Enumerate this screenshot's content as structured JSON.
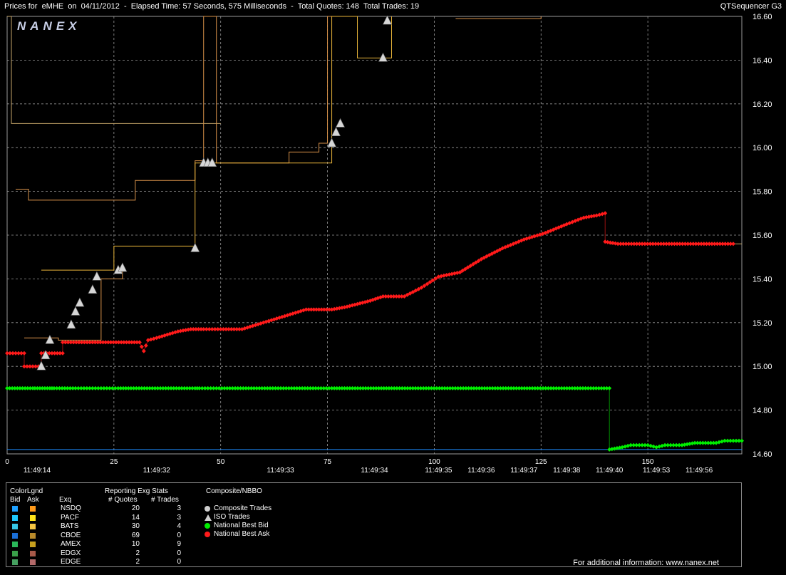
{
  "header": {
    "title": "Prices for  eMHE  on  04/11/2012  -  Elapsed Time: 57 Seconds, 575 Milliseconds  -  Total Quotes: 148  Total Trades: 19",
    "sequencer": "QTSequencer G3",
    "logo": "NANEX"
  },
  "colors": {
    "background": "#000000",
    "grid": "#9a9a9a",
    "nbbo_bid": "#00ee00",
    "nbbo_ask": "#ff1a1a",
    "iso_trade": "#d6d6d6",
    "quote_line_gold": "#e8b43a",
    "quote_line_orange": "#d9924a",
    "quote_line_tan": "#c7a76a",
    "blue_line": "#1c8cff"
  },
  "chart_data": {
    "type": "line",
    "ylim": [
      14.6,
      16.6
    ],
    "y_ticks": [
      "16.60",
      "16.40",
      "16.20",
      "16.00",
      "15.80",
      "15.60",
      "15.40",
      "15.20",
      "15.00",
      "14.80",
      "14.60"
    ],
    "xlim": [
      0,
      172
    ],
    "x_index_ticks": [
      {
        "x": 0,
        "label": "0"
      },
      {
        "x": 25,
        "label": "25"
      },
      {
        "x": 50,
        "label": "50"
      },
      {
        "x": 75,
        "label": "75"
      },
      {
        "x": 100,
        "label": "100"
      },
      {
        "x": 125,
        "label": "125"
      },
      {
        "x": 150,
        "label": "150"
      }
    ],
    "time_ticks": [
      {
        "x": 7,
        "label": "11:49:14"
      },
      {
        "x": 35,
        "label": "11:49:32"
      },
      {
        "x": 64,
        "label": "11:49:33"
      },
      {
        "x": 86,
        "label": "11:49:34"
      },
      {
        "x": 101,
        "label": "11:49:35"
      },
      {
        "x": 111,
        "label": "11:49:36"
      },
      {
        "x": 121,
        "label": "11:49:37"
      },
      {
        "x": 131,
        "label": "11:49:38"
      },
      {
        "x": 141,
        "label": "11:49:40"
      },
      {
        "x": 152,
        "label": "11:49:53"
      },
      {
        "x": 162,
        "label": "11:49:56"
      }
    ],
    "series": [
      {
        "name": "National Best Bid",
        "color": "#00ee00",
        "points": [
          [
            0,
            14.9
          ],
          [
            6,
            14.9
          ],
          [
            6.5,
            14.9
          ],
          [
            10,
            14.9
          ],
          [
            11,
            14.9
          ],
          [
            16,
            14.9
          ],
          [
            18,
            14.9
          ],
          [
            20,
            14.9
          ],
          [
            22,
            14.9
          ],
          [
            26,
            14.9
          ],
          [
            29,
            14.9
          ],
          [
            44,
            14.9
          ],
          [
            45,
            14.9
          ],
          [
            49,
            14.9
          ],
          [
            76,
            14.9
          ],
          [
            79,
            14.9
          ],
          [
            87,
            14.9
          ],
          [
            90,
            14.9
          ],
          [
            141,
            14.9
          ],
          [
            141,
            14.62
          ],
          [
            144,
            14.63
          ],
          [
            146,
            14.64
          ],
          [
            150,
            14.64
          ],
          [
            152,
            14.63
          ],
          [
            154,
            14.64
          ],
          [
            158,
            14.64
          ],
          [
            161,
            14.65
          ],
          [
            166,
            14.65
          ],
          [
            168,
            14.66
          ],
          [
            172,
            14.66
          ]
        ]
      },
      {
        "name": "National Best Ask",
        "color": "#ff1a1a",
        "points": [
          [
            0,
            15.06
          ],
          [
            4,
            15.06
          ],
          [
            4,
            15.0
          ],
          [
            8,
            15.0
          ],
          [
            8,
            15.06
          ],
          [
            13,
            15.06
          ],
          [
            13,
            15.11
          ],
          [
            20,
            15.11
          ],
          [
            31,
            15.11
          ],
          [
            32,
            15.07
          ],
          [
            33,
            15.12
          ],
          [
            35,
            15.13
          ],
          [
            40,
            15.16
          ],
          [
            43,
            15.17
          ],
          [
            46,
            15.17
          ],
          [
            50,
            15.17
          ],
          [
            55,
            15.17
          ],
          [
            60,
            15.2
          ],
          [
            65,
            15.23
          ],
          [
            70,
            15.26
          ],
          [
            76,
            15.26
          ],
          [
            79,
            15.27
          ],
          [
            85,
            15.3
          ],
          [
            88,
            15.32
          ],
          [
            93,
            15.32
          ],
          [
            97,
            15.36
          ],
          [
            101,
            15.41
          ],
          [
            106,
            15.43
          ],
          [
            111,
            15.49
          ],
          [
            116,
            15.54
          ],
          [
            121,
            15.58
          ],
          [
            126,
            15.61
          ],
          [
            131,
            15.65
          ],
          [
            135,
            15.68
          ],
          [
            138,
            15.69
          ],
          [
            140,
            15.7
          ],
          [
            140,
            15.57
          ],
          [
            143,
            15.56
          ],
          [
            160,
            15.56
          ],
          [
            170,
            15.56
          ]
        ]
      },
      {
        "name": "ISO Trades",
        "color": "#d6d6d6",
        "points": [
          [
            8,
            15.0
          ],
          [
            9,
            15.05
          ],
          [
            10,
            15.12
          ],
          [
            15,
            15.19
          ],
          [
            16,
            15.25
          ],
          [
            17,
            15.29
          ],
          [
            20,
            15.35
          ],
          [
            21,
            15.41
          ],
          [
            26,
            15.44
          ],
          [
            27,
            15.45
          ],
          [
            44,
            15.54
          ],
          [
            46,
            15.93
          ],
          [
            47,
            15.93
          ],
          [
            48,
            15.93
          ],
          [
            76,
            16.02
          ],
          [
            77,
            16.07
          ],
          [
            78,
            16.11
          ],
          [
            88,
            16.41
          ],
          [
            89,
            16.58
          ]
        ]
      }
    ]
  },
  "legend": {
    "color_legend_title": "ColorLgnd",
    "bid_header": "Bid",
    "ask_header": "Ask",
    "exchange_header": "Exq",
    "stats_title": "Reporting Exg Stats",
    "quotes_header": "# Quotes",
    "trades_header": "# Trades",
    "composite_title": "Composite/NBBO",
    "exchanges": [
      {
        "name": "NSDQ",
        "quotes": "20",
        "trades": "3",
        "bid_color": "#1ea0ff",
        "ask_color": "#ff9a1a"
      },
      {
        "name": "PACF",
        "quotes": "14",
        "trades": "3",
        "bid_color": "#1ec8ff",
        "ask_color": "#ffe41a"
      },
      {
        "name": "BATS",
        "quotes": "30",
        "trades": "4",
        "bid_color": "#36c6e6",
        "ask_color": "#f5c542"
      },
      {
        "name": "CBOE",
        "quotes": "69",
        "trades": "0",
        "bid_color": "#1a6ed6",
        "ask_color": "#b98a2a"
      },
      {
        "name": "AMEX",
        "quotes": "10",
        "trades": "9",
        "bid_color": "#2ab85a",
        "ask_color": "#c7a01e"
      },
      {
        "name": "EDGX",
        "quotes": "2",
        "trades": "0",
        "bid_color": "#3aa04a",
        "ask_color": "#a85a4a"
      },
      {
        "name": "EDGE",
        "quotes": "2",
        "trades": "0",
        "bid_color": "#46a060",
        "ask_color": "#b46a6a"
      }
    ],
    "composite_items": [
      {
        "label": "Composite Trades",
        "marker": "circle",
        "color": "#cfcfcf"
      },
      {
        "label": "ISO Trades",
        "marker": "triangle",
        "color": "#cfcfcf"
      },
      {
        "label": "National Best Bid",
        "marker": "circle",
        "color": "#00ee00"
      },
      {
        "label": "National Best Ask",
        "marker": "circle",
        "color": "#ff1a1a"
      }
    ]
  },
  "footer": {
    "text": "For additional information: www.nanex.net"
  }
}
